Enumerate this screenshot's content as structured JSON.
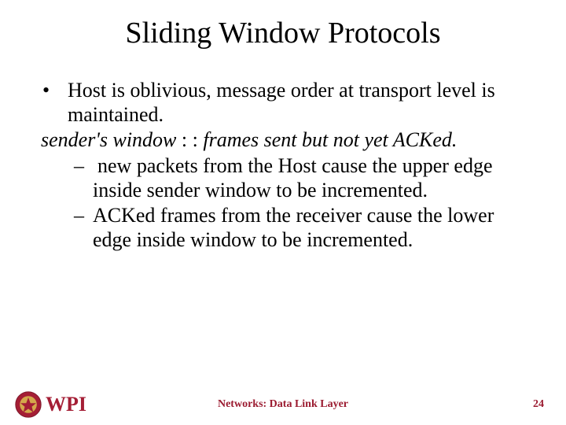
{
  "title": "Sliding Window Protocols",
  "bullets": {
    "b1": "Host is oblivious, message order at transport level is maintained."
  },
  "definition": {
    "term": "sender's window",
    "sep": " : : ",
    "desc": "frames sent but not yet ACKed."
  },
  "sub": {
    "s1": "new packets from the Host cause the upper edge inside sender window to be incremented.",
    "s2": "ACKed  frames from the receiver cause the lower edge inside window to be incremented."
  },
  "footer": {
    "center": "Networks: Data Link Layer",
    "page": "24"
  },
  "logo": {
    "text": "WPI"
  }
}
